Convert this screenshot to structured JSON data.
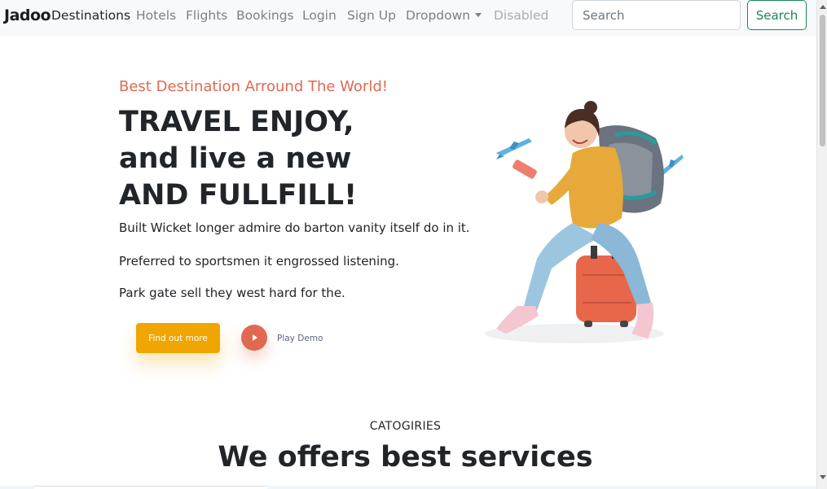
{
  "navbar": {
    "brand": "Jadoo",
    "links": [
      {
        "label": "Destinations",
        "state": "active"
      },
      {
        "label": "Hotels",
        "state": "normal"
      },
      {
        "label": "Flights",
        "state": "normal"
      },
      {
        "label": "Bookings",
        "state": "normal"
      },
      {
        "label": "Login",
        "state": "normal"
      },
      {
        "label": "Sign Up",
        "state": "normal"
      },
      {
        "label": "Dropdown",
        "state": "dropdown"
      },
      {
        "label": "Disabled",
        "state": "disabled"
      }
    ],
    "search_placeholder": "Search",
    "search_button": "Search"
  },
  "hero": {
    "subtitle": "Best Destination Arround The World!",
    "title_lines": [
      "TRAVEL ENJOY,",
      "and live a new",
      "AND FULLFILL!"
    ],
    "paragraphs": [
      "Built Wicket longer admire do barton vanity itself do in it.",
      "Preferred to sportsmen it engrossed listening.",
      "Park gate sell they west hard for the."
    ],
    "primary_button": "Find out more",
    "play_label": "Play Demo",
    "image_icon": "traveler-with-suitcase-and-planes"
  },
  "categories": {
    "label": "CATOGIRIES",
    "title": "We offers best services"
  },
  "colors": {
    "accent": "#df6951",
    "button_yellow": "#f1a501",
    "search_green": "#198754",
    "navbar_bg": "#f8f9fa"
  }
}
